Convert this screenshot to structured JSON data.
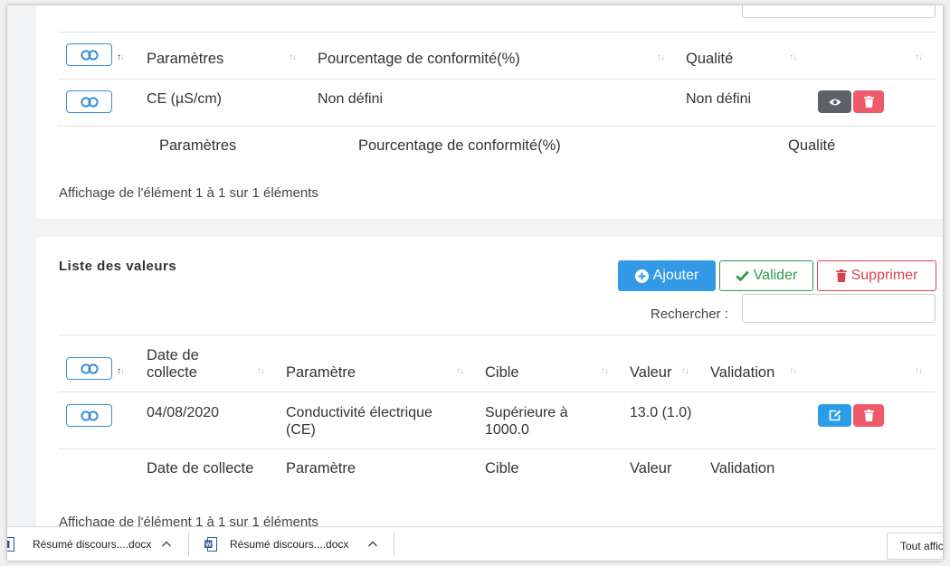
{
  "results_table": {
    "headers": {
      "param": "Paramètres",
      "pct": "Pourcentage de conformité(%)",
      "quality": "Qualité"
    },
    "rows": [
      {
        "param": "CE (µS/cm)",
        "pct": "Non défini",
        "quality": "Non défini"
      }
    ],
    "footer": {
      "param": "Paramètres",
      "pct": "Pourcentage de conformité(%)",
      "quality": "Qualité"
    },
    "info": "Affichage de l'élément 1 à 1 sur 1 éléments"
  },
  "values_card": {
    "title": "Liste des valeurs",
    "buttons": {
      "add": "Ajouter",
      "validate": "Valider",
      "delete": "Supprimer"
    },
    "search_label": "Rechercher :",
    "search_value": "",
    "headers": {
      "date_line1": "Date de",
      "date_line2": "collecte",
      "param": "Paramètre",
      "target": "Cible",
      "value": "Valeur",
      "validation": "Validation"
    },
    "rows": [
      {
        "date": "04/08/2020",
        "param_line1": "Conductivité électrique",
        "param_line2": "(CE)",
        "target_line1": "Supérieure à",
        "target_line2": "1000.0",
        "value": "13.0 (1.0)",
        "validation": ""
      }
    ],
    "footer": {
      "date": "Date de collecte",
      "param": "Paramètre",
      "target": "Cible",
      "value": "Valeur",
      "validation": "Validation"
    },
    "info": "Affichage de l'élément 1 à 1 sur 1 éléments"
  },
  "taskbar": {
    "items": [
      {
        "label": "Résumé discours....docx"
      },
      {
        "label": "Résumé discours....docx"
      }
    ],
    "show_all": "Tout afficher"
  },
  "colors": {
    "primary": "#3399e6",
    "success": "#2e9a4e",
    "danger": "#d9434f",
    "secondary": "#5a6268"
  }
}
